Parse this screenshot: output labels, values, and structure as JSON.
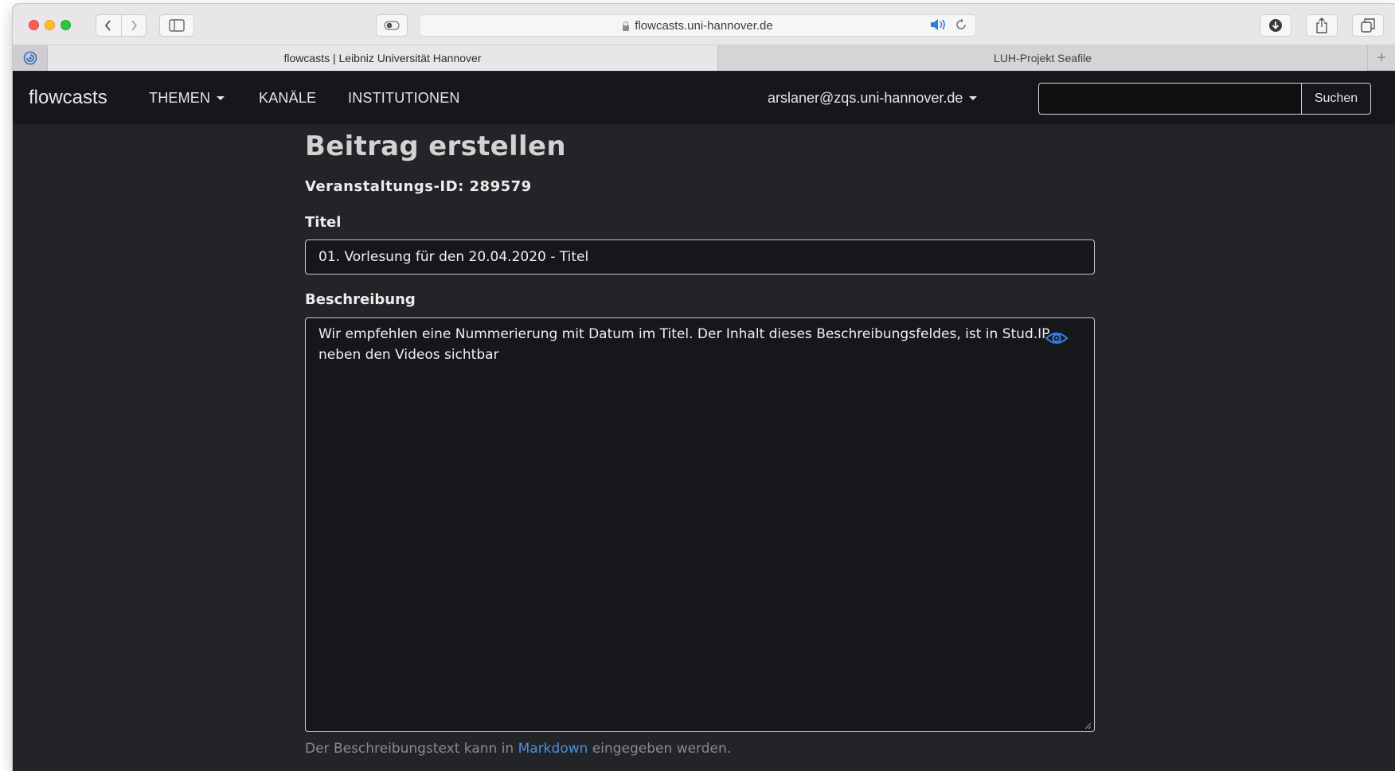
{
  "browser": {
    "url": "flowcasts.uni-hannover.de",
    "tabs": [
      {
        "label": "flowcasts | Leibniz Universität Hannover",
        "active": true
      },
      {
        "label": "LUH-Projekt Seafile",
        "active": false
      }
    ],
    "new_tab_label": "+"
  },
  "navbar": {
    "brand": "flowcasts",
    "items": [
      {
        "label": "THEMEN",
        "dropdown": true
      },
      {
        "label": "KANÄLE",
        "dropdown": false
      },
      {
        "label": "INSTITUTIONEN",
        "dropdown": false
      }
    ],
    "user": "arslaner@zqs.uni-hannover.de",
    "search_value": "",
    "search_button": "Suchen"
  },
  "form": {
    "heading": "Beitrag erstellen",
    "event_id": "Veranstaltungs-ID: 289579",
    "title_label": "Titel",
    "title_value": "01. Vorlesung für den 20.04.2020 - Titel",
    "description_label": "Beschreibung",
    "description_value": "Wir empfehlen eine Nummerierung mit Datum im Titel. Der Inhalt dieses Beschreibungsfeldes, ist in Stud.IP neben den Videos sichtbar",
    "help_prefix": "Der Beschreibungstext kann in ",
    "help_link": "Markdown",
    "help_suffix": " eingegeben werden."
  },
  "colors": {
    "accent": "#4a90d9",
    "navbar_bg": "#16171a",
    "page_bg": "#232427"
  }
}
